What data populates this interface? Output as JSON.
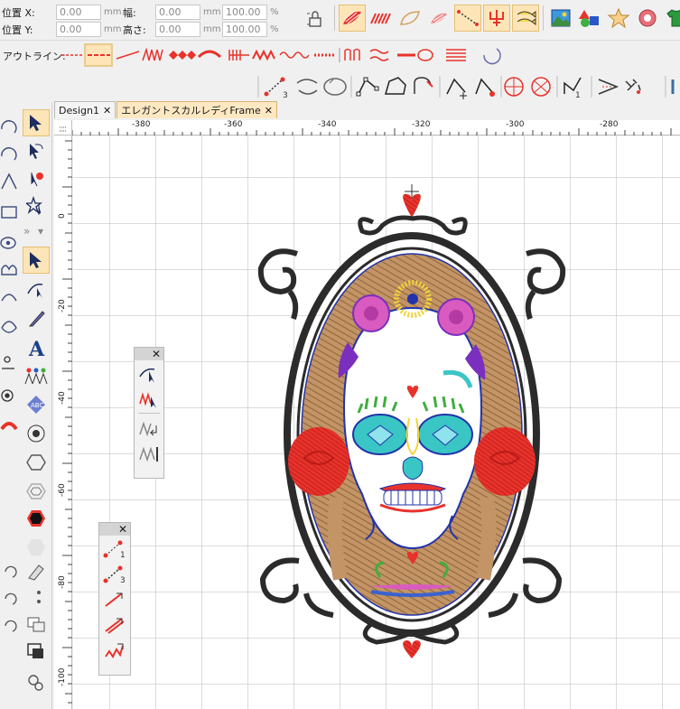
{
  "position_panel": {
    "x_label": "位置 X:",
    "y_label": "位置 Y:",
    "x_value": "0.00",
    "y_value": "0.00",
    "x_unit": "mm",
    "y_unit": "mm",
    "width_label": "幅:",
    "height_label": "高さ:",
    "width_value": "0.00",
    "height_value": "0.00",
    "width_unit": "mm",
    "height_unit": "mm",
    "scale_w": "100.00",
    "scale_h": "100.00",
    "scale_unit_w": "%",
    "scale_unit_h": "%"
  },
  "outline_bar": {
    "label": "アウトライン:"
  },
  "tabs": [
    {
      "label": "Design1",
      "close": "✕"
    },
    {
      "label": "エレガントスカルレディFrame",
      "close": "✕"
    }
  ],
  "ruler_top": [
    "-380",
    "-360",
    "-340",
    "-320",
    "-300",
    "-280"
  ],
  "ruler_left": [
    "0",
    "-20",
    "-40",
    "-60",
    "-80",
    "-100"
  ],
  "float_panel_1": {
    "close": "✕",
    "numbers": []
  },
  "float_panel_2": {
    "close": "✕",
    "numbers": [
      "1",
      "3"
    ]
  },
  "colors": {
    "accent": "#fde5b8",
    "stitch_red": "#e8322b",
    "stitch_black": "#262626",
    "stitch_tan": "#c29466",
    "stitch_blue": "#2233aa",
    "stitch_teal": "#39c6c4",
    "stitch_pink": "#d95bbf",
    "stitch_purple": "#7b2fbf"
  }
}
